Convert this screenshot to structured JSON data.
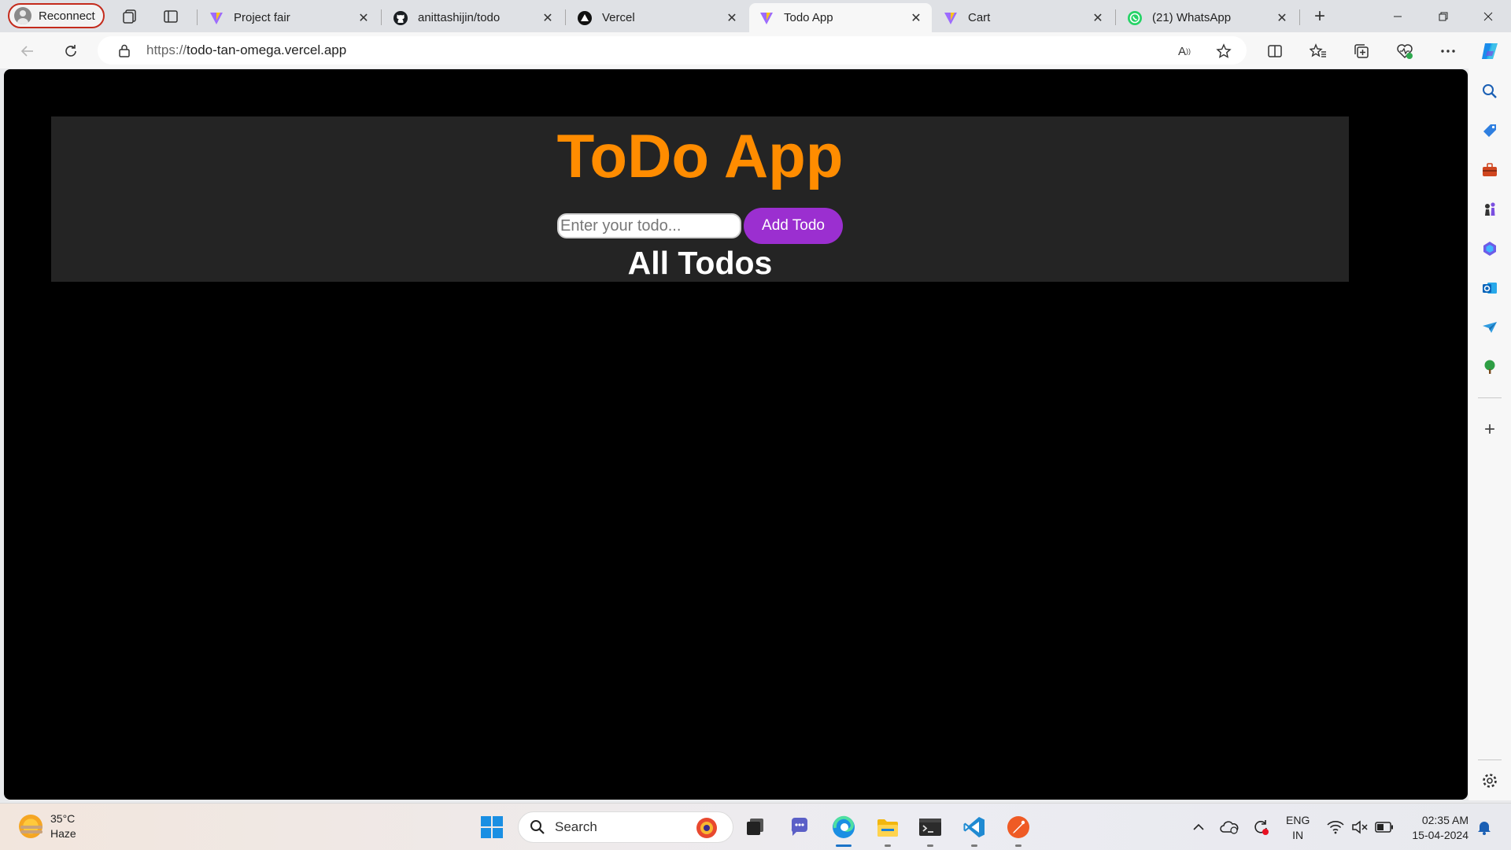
{
  "browser": {
    "profile_label": "Reconnect",
    "tabs": [
      {
        "label": "Project fair",
        "icon": "vite-icon",
        "active": false
      },
      {
        "label": "anittashijin/todo",
        "icon": "github-icon",
        "active": false
      },
      {
        "label": "Vercel",
        "icon": "vercel-icon",
        "active": false
      },
      {
        "label": "Todo App",
        "icon": "vite-icon",
        "active": true
      },
      {
        "label": "Cart",
        "icon": "vite-icon",
        "active": false
      },
      {
        "label": "(21) WhatsApp",
        "icon": "whatsapp-icon",
        "active": false
      }
    ],
    "url_protocol": "https://",
    "url_host": "todo-tan-omega.vercel.app"
  },
  "app": {
    "title": "ToDo App",
    "input_placeholder": "Enter your todo...",
    "input_value": "",
    "add_button_label": "Add Todo",
    "list_heading": "All Todos",
    "colors": {
      "title": "#ff8c00",
      "button": "#9b2fd0",
      "panel": "#242424",
      "background": "#000000"
    }
  },
  "taskbar": {
    "weather_temp": "35°C",
    "weather_desc": "Haze",
    "search_label": "Search",
    "lang_primary": "ENG",
    "lang_region": "IN",
    "time": "02:35 AM",
    "date": "15-04-2024"
  }
}
